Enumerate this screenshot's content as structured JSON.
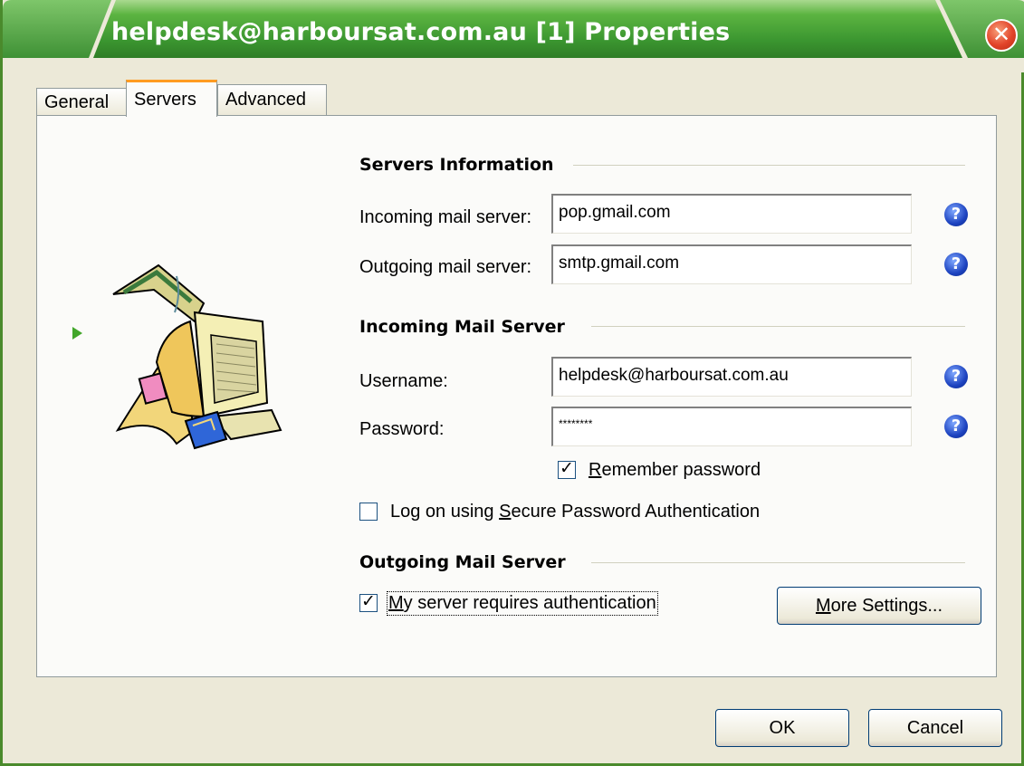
{
  "window": {
    "title": "helpdesk@harboursat.com.au [1] Properties"
  },
  "tabs": [
    {
      "label": "General",
      "active": false
    },
    {
      "label": "Servers",
      "active": true
    },
    {
      "label": "Advanced",
      "active": false
    }
  ],
  "servers_info": {
    "heading": "Servers Information",
    "incoming_label": "Incoming mail server:",
    "incoming_value": "pop.gmail.com",
    "outgoing_label": "Outgoing mail server:",
    "outgoing_value": "smtp.gmail.com"
  },
  "incoming_server": {
    "heading": "Incoming Mail Server",
    "username_label": "Username:",
    "username_value": "helpdesk@harboursat.com.au",
    "password_label": "Password:",
    "password_value": "********",
    "remember_password": {
      "label_prefix": "",
      "label_accel": "R",
      "label_rest": "emember password",
      "checked": true
    },
    "spa": {
      "label_prefix": "Log on using ",
      "label_accel": "S",
      "label_rest": "ecure Password Authentication",
      "checked": false
    }
  },
  "outgoing_server": {
    "heading": "Outgoing Mail Server",
    "requires_auth": {
      "label_prefix": "",
      "label_accel": "M",
      "label_rest": "y server requires authentication",
      "checked": true
    },
    "more_settings": {
      "label_prefix": "",
      "label_accel": "M",
      "label_rest": "ore Settings..."
    }
  },
  "buttons": {
    "ok": "OK",
    "cancel": "Cancel"
  },
  "colors": {
    "titlebar_green": "#3f9c35",
    "dialog_bg": "#ece9d8",
    "help_blue": "#1d43c0",
    "close_red": "#e2442a"
  },
  "icons": [
    "close-icon",
    "help-icon",
    "mail-computer-illustration",
    "play-arrow-icon"
  ]
}
